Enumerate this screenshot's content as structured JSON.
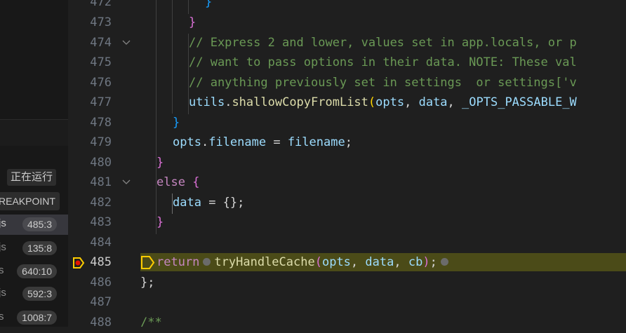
{
  "sidebar": {
    "running_label": "正在运行",
    "breakpoint_label": "REAKPOINT",
    "frames": [
      {
        "file": "js",
        "pos": "485:3",
        "active": true
      },
      {
        "file": "js",
        "pos": "135:8",
        "active": false
      },
      {
        "file": "s",
        "pos": "640:10",
        "active": false
      },
      {
        "file": "js",
        "pos": "592:3",
        "active": false
      },
      {
        "file": "s",
        "pos": "1008:7",
        "active": false
      }
    ]
  },
  "editor": {
    "current_line": 485,
    "lines": [
      {
        "n": "472"
      },
      {
        "n": "473"
      },
      {
        "n": "474"
      },
      {
        "n": "475"
      },
      {
        "n": "476"
      },
      {
        "n": "477"
      },
      {
        "n": "478"
      },
      {
        "n": "479"
      },
      {
        "n": "480"
      },
      {
        "n": "481"
      },
      {
        "n": "482"
      },
      {
        "n": "483"
      },
      {
        "n": "484"
      },
      {
        "n": "485"
      },
      {
        "n": "486"
      },
      {
        "n": "487"
      },
      {
        "n": "488"
      }
    ],
    "code": {
      "l472": "}",
      "l473": "}",
      "l474": "// Express 2 and lower, values set in app.locals, or p",
      "l475": "// want to pass options in their data. NOTE: These val",
      "l476": "// anything previously set in settings  or settings['v",
      "l477_obj": "utils",
      "l477_dot": ".",
      "l477_fn": "shallowCopyFromList",
      "l477_paren": "(",
      "l477_a1": "opts",
      "l477_comma1": ", ",
      "l477_a2": "data",
      "l477_comma2": ", ",
      "l477_a3": "_OPTS_PASSABLE_W",
      "l478": "}",
      "l479_obj": "opts",
      "l479_dot": ".",
      "l479_prop": "filename",
      "l479_eq": " = ",
      "l479_val": "filename",
      "l479_semi": ";",
      "l480": "}",
      "l481_kw": "else",
      "l481_brace": " {",
      "l482_var": "data",
      "l482_rest": " = {};",
      "l483": "}",
      "l485_kw": "return",
      "l485_fn": "tryHandleCache",
      "l485_open": "(",
      "l485_a1": "opts",
      "l485_c1": ", ",
      "l485_a2": "data",
      "l485_c2": ", ",
      "l485_a3": "cb",
      "l485_close": ")",
      "l485_semi": ";",
      "l486": "};",
      "l488": "/**"
    }
  },
  "colors": {
    "breakpoint": "#e51400",
    "current_line_arrow": "#ffcc00",
    "current_line_bg": "#4b4b18"
  }
}
